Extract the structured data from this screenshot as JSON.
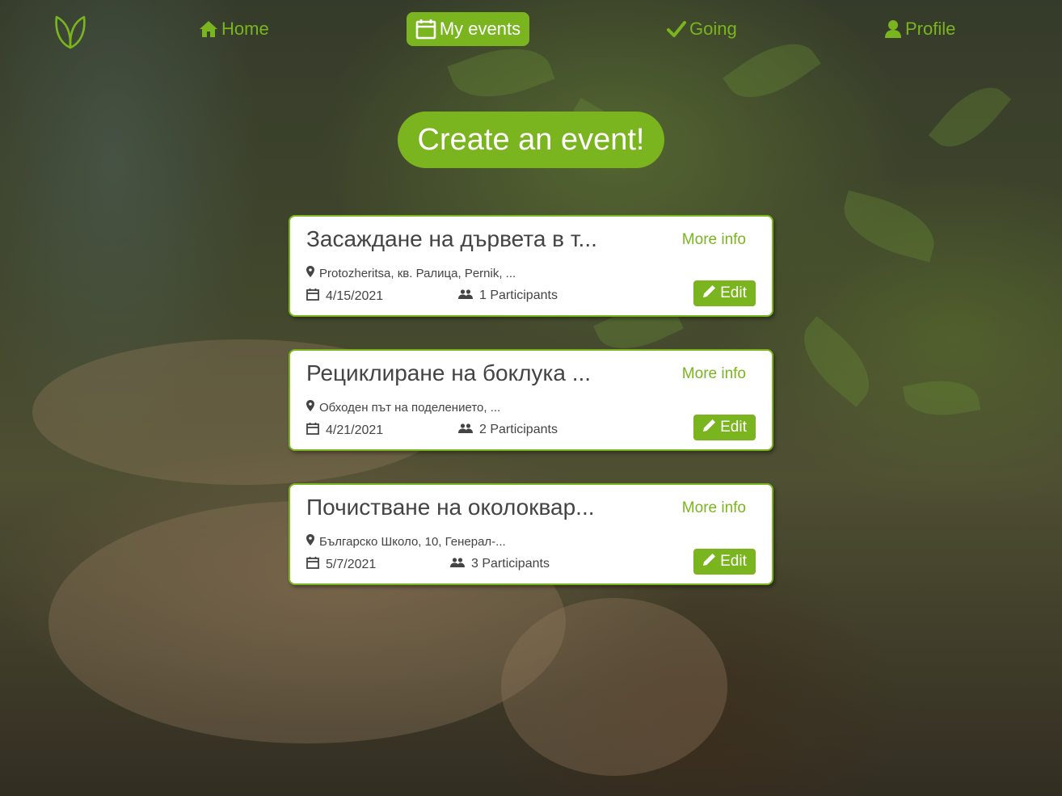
{
  "nav": {
    "logo_icon": "leaf-logo-icon",
    "items": [
      {
        "label": "Home",
        "icon": "home-icon"
      },
      {
        "label": "My events",
        "icon": "calendar-icon",
        "active": true
      },
      {
        "label": "Going",
        "icon": "check-icon"
      },
      {
        "label": "Profile",
        "icon": "user-icon"
      }
    ]
  },
  "create_button": {
    "label": "Create an event!"
  },
  "events": [
    {
      "title": "Засаждане на дървета в т...",
      "location": "Protozheritsa, кв. Ралица, Pernik, ...",
      "date": "4/15/2021",
      "participants": "1 Participants",
      "more_info": "More info",
      "edit": "Edit"
    },
    {
      "title": "Рециклиране на боклука ...",
      "location": "Обходен път на поделението, ...",
      "date": "4/21/2021",
      "participants": "2 Participants",
      "more_info": "More info",
      "edit": "Edit"
    },
    {
      "title": "Почистване на околоквар...",
      "location": "Българско Школо, 10, Генерал-...",
      "date": "5/7/2021",
      "participants": "3 Participants",
      "more_info": "More info",
      "edit": "Edit"
    }
  ],
  "colors": {
    "accent": "#7ab520",
    "card_bg": "#ffffff",
    "text": "#444444"
  }
}
